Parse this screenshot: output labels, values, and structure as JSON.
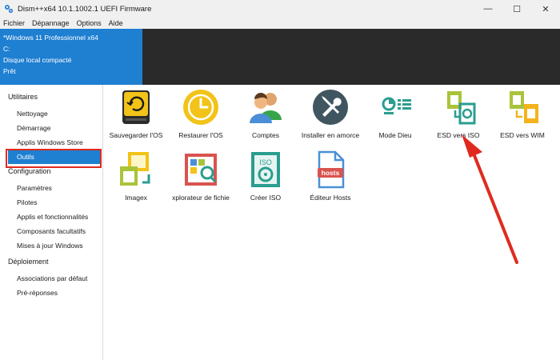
{
  "window": {
    "title": "Dism++x64 10.1.1002.1 UEFI Firmware",
    "controls": {
      "minimize": "—",
      "maximize": "☐",
      "close": "✕"
    }
  },
  "menu": [
    {
      "label": "Fichier"
    },
    {
      "label": "Dépannage"
    },
    {
      "label": "Options"
    },
    {
      "label": "Aide"
    }
  ],
  "info": {
    "os": "*Windows 11 Professionnel x64",
    "drive": "C:",
    "disk": "Disque local compacté",
    "status": "Prêt"
  },
  "sidebar": {
    "groups": [
      {
        "label": "Utilitaires",
        "items": [
          "Nettoyage",
          "Démarrage",
          "Applis Windows Store",
          "Outils"
        ]
      },
      {
        "label": "Configuration",
        "items": [
          "Paramètres",
          "Pilotes",
          "Applis et fonctionnalités",
          "Composants facultatifs",
          "Mises à jour Windows"
        ]
      },
      {
        "label": "Déploiement",
        "items": [
          "Associations par défaut",
          "Pré-réponses"
        ]
      }
    ],
    "selected": "Outils"
  },
  "tools": [
    {
      "label": "Sauvegarder l'OS",
      "icon": "backup-drive-icon"
    },
    {
      "label": "Restaurer l'OS",
      "icon": "restore-clock-icon"
    },
    {
      "label": "Comptes",
      "icon": "accounts-icon"
    },
    {
      "label": "Installer en amorce",
      "icon": "wrench-screwdriver-icon"
    },
    {
      "label": "Mode Dieu",
      "icon": "god-mode-icon"
    },
    {
      "label": "ESD vers ISO",
      "icon": "esd-to-iso-icon"
    },
    {
      "label": "ESD vers WIM",
      "icon": "esd-to-wim-icon"
    },
    {
      "label": "Imagex",
      "icon": "imagex-icon"
    },
    {
      "label": "xplorateur de fichie",
      "icon": "file-explorer-icon"
    },
    {
      "label": "Créer ISO",
      "icon": "create-iso-icon"
    },
    {
      "label": "Éditeur Hosts",
      "icon": "hosts-editor-icon"
    }
  ],
  "icon_text": {
    "iso": "ISO",
    "hosts": "hosts"
  },
  "colors": {
    "accent": "#1f7fd1",
    "annotation": "#e02a1f"
  }
}
